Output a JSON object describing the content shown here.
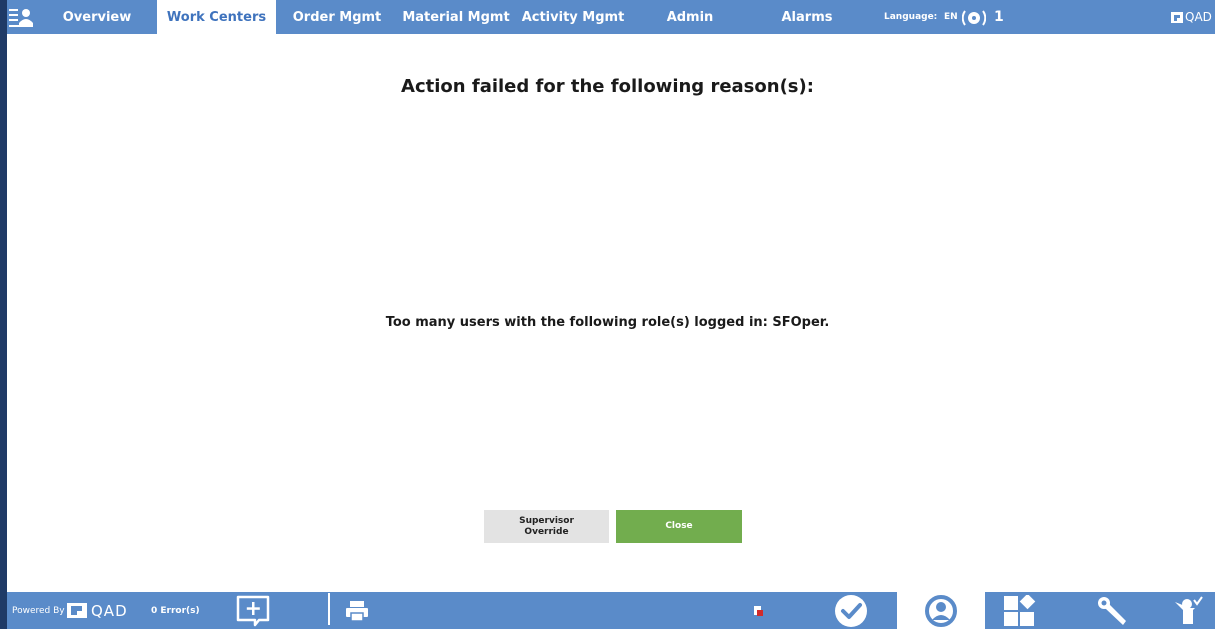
{
  "nav": {
    "tabs": [
      {
        "label": "Overview",
        "active": false
      },
      {
        "label": "Work Centers",
        "active": true
      },
      {
        "label": "Order Mgmt",
        "active": false
      },
      {
        "label": "Material Mgmt",
        "active": false
      },
      {
        "label": "Activity Mgmt",
        "active": false
      },
      {
        "label": "Admin",
        "active": false
      },
      {
        "label": "Alarms",
        "active": false
      }
    ],
    "language_label": "Language:",
    "language_value": "EN",
    "signal_count": "1",
    "brand": "QAD"
  },
  "dialog": {
    "title": "Action failed for the following reason(s):",
    "message": "Too many users with the following role(s) logged in: SFOper.",
    "supervisor_button": "Supervisor Override",
    "close_button": "Close"
  },
  "footer": {
    "powered_by": "Powered By",
    "brand": "QAD",
    "errors": "0 Error(s)"
  },
  "colors": {
    "bar": "#5a8bc9",
    "active_tab_text": "#3f73bd",
    "close_button": "#72ad4e",
    "supervisor_button": "#e3e3e3"
  },
  "icons": {
    "bottom": [
      "add-comment-icon",
      "print-icon",
      "flag-icon",
      "check-circle-icon",
      "user-circle-icon",
      "dashboard-tiles-icon",
      "wrench-icon",
      "user-check-icon"
    ]
  }
}
